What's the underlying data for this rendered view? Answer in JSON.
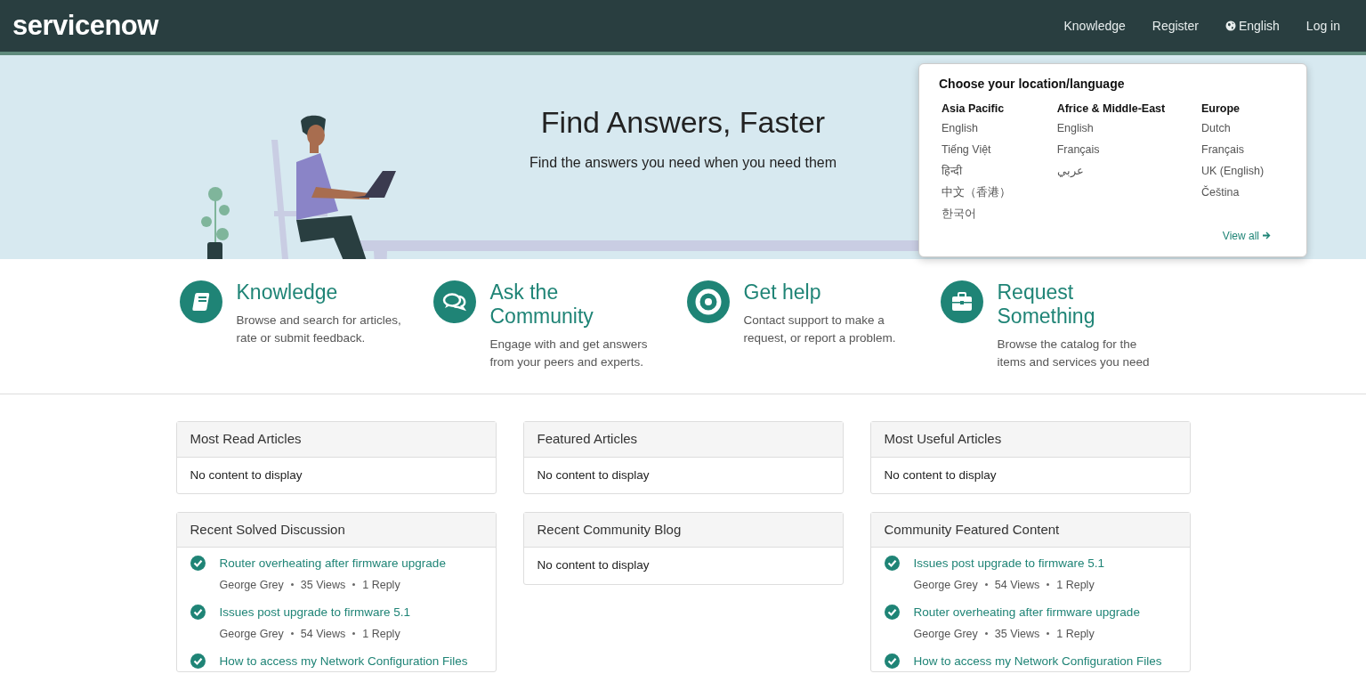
{
  "navbar": {
    "logo": "servicenow",
    "links": [
      {
        "label": "Knowledge",
        "kind": "text"
      },
      {
        "label": "Register",
        "kind": "text"
      },
      {
        "label": "English",
        "kind": "globe"
      },
      {
        "label": "Log in",
        "kind": "text"
      }
    ]
  },
  "language_popover": {
    "title": "Choose your location/language",
    "regions": [
      {
        "name": "Asia Pacific",
        "languages": [
          "English",
          "Tiếng Việt",
          "हिन्दी",
          "中文（香港）",
          "한국어"
        ]
      },
      {
        "name": "Africe & Middle-East",
        "languages": [
          "English",
          "Français",
          "عربي"
        ]
      },
      {
        "name": "Europe",
        "languages": [
          "Dutch",
          "Français",
          "UK (English)",
          "Čeština"
        ]
      }
    ],
    "view_all": "View all"
  },
  "hero": {
    "title": "Find Answers, Faster",
    "subtitle": "Find the answers you need when you need them"
  },
  "features": [
    {
      "title": "Knowledge",
      "description": "Browse and search for articles, rate or submit feedback."
    },
    {
      "title": "Ask the Community",
      "description": "Engage with and get answers from your peers and experts."
    },
    {
      "title": "Get help",
      "description": "Contact support to make a request, or report a problem."
    },
    {
      "title": "Request Something",
      "description": "Browse the catalog for the items and services you need"
    }
  ],
  "panels": [
    [
      {
        "title": "Most Read Articles",
        "empty_text": "No content to display"
      },
      {
        "title": "Recent Solved Discussion",
        "items": [
          {
            "title": "Router overheating after firmware upgrade",
            "author": "George Grey",
            "views": "35 Views",
            "replies": "1 Reply"
          },
          {
            "title": "Issues post upgrade to firmware 5.1",
            "author": "George Grey",
            "views": "54 Views",
            "replies": "1 Reply"
          },
          {
            "title": "How to access my Network Configuration Files"
          }
        ]
      }
    ],
    [
      {
        "title": "Featured Articles",
        "empty_text": "No content to display"
      },
      {
        "title": "Recent Community Blog",
        "empty_text": "No content to display"
      }
    ],
    [
      {
        "title": "Most Useful Articles",
        "empty_text": "No content to display"
      },
      {
        "title": "Community Featured Content",
        "items": [
          {
            "title": "Issues post upgrade to firmware 5.1",
            "author": "George Grey",
            "views": "54 Views",
            "replies": "1 Reply"
          },
          {
            "title": "Router overheating after firmware upgrade",
            "author": "George Grey",
            "views": "35 Views",
            "replies": "1 Reply"
          },
          {
            "title": "How to access my Network Configuration Files"
          }
        ]
      }
    ]
  ]
}
